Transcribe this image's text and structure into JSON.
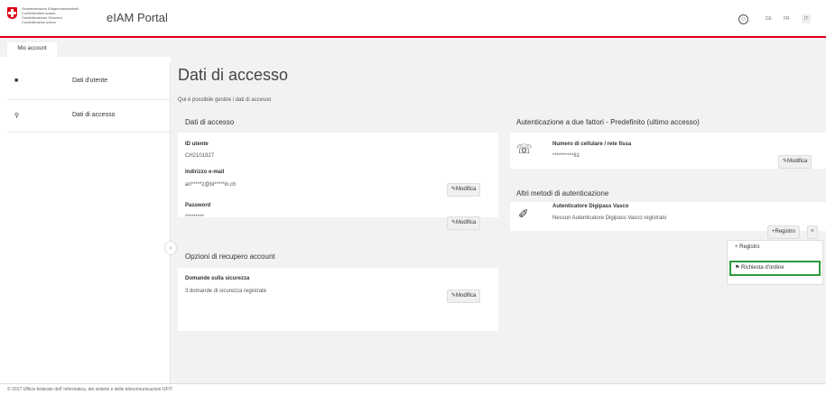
{
  "header": {
    "confederation_lines": [
      "Schweizerische Eidgenossenschaft",
      "Confédération suisse",
      "Confederazione Svizzera",
      "Confederaziun svizra"
    ],
    "portal_title": "eIAM Portal",
    "languages": [
      "DE",
      "FR",
      "IT"
    ],
    "active_language": "IT"
  },
  "tabs": {
    "account": "Mio account"
  },
  "sidebar": {
    "items": [
      {
        "label": "Dati d'utente",
        "icon": "user-icon"
      },
      {
        "label": "Dati di accesso",
        "icon": "key-icon"
      }
    ]
  },
  "page": {
    "title": "Dati di accesso",
    "subtitle": "Qui è possibile gestire i dati di accesso"
  },
  "access": {
    "heading": "Dati di accesso",
    "user_id_label": "ID utente",
    "user_id_value": "CH2101927",
    "email_label": "Indirizzo e-mail",
    "email_value": "an*****z@bi*****in.ch",
    "password_label": "Password",
    "password_value": "*********",
    "modify_label": "Modifica"
  },
  "recovery": {
    "heading": "Opzioni di recupero account",
    "questions_label": "Domande sulla sicurezza",
    "questions_value": "3 domande di sicurezza registrate",
    "modify_label": "Modifica"
  },
  "twofactor": {
    "heading": "Autenticazione a due fattori - Predefinito (ultimo accesso)",
    "phone_label": "Numero di cellulare / rete fissa",
    "phone_value": "**********61",
    "modify_label": "Modifica"
  },
  "other_methods": {
    "heading": "Altri metodi di autenticazione",
    "digipass_label": "Autenticatore Digipass Vasco",
    "digipass_value": "Nessun Autenticatore Digipass Vasco registrato",
    "register_label": "Registro"
  },
  "dropdown": {
    "items": [
      {
        "label": "Registro",
        "icon": "plus-icon"
      },
      {
        "label": "Richiesta d'ordine",
        "icon": "flag-icon"
      }
    ]
  },
  "footer": {
    "text": "© 2017 Ufficio federale dell' informatica, dei sistemi e delle telecomunicazioni UFIT"
  },
  "colors": {
    "brand_red": "#dc0018",
    "highlight_green": "#2c9b3a"
  }
}
